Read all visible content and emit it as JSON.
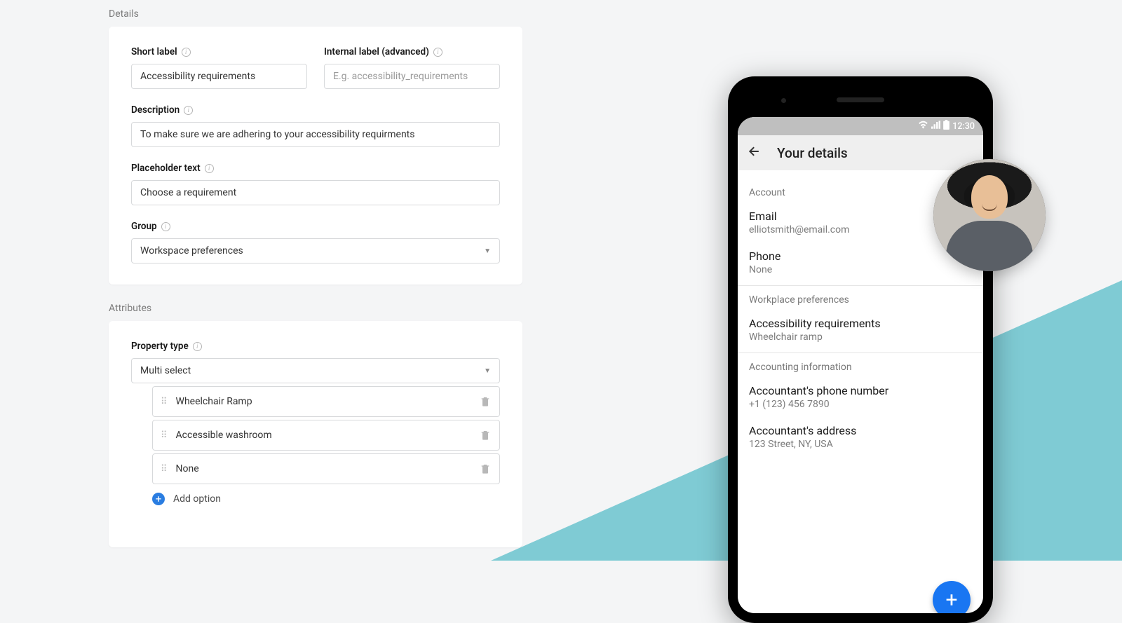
{
  "left": {
    "details_title": "Details",
    "short_label": {
      "label": "Short label",
      "value": "Accessibility requirements"
    },
    "internal_label": {
      "label": "Internal label (advanced)",
      "placeholder": "E.g. accessibility_requirements"
    },
    "description": {
      "label": "Description",
      "value": "To make sure we are adhering to your accessibility requirments"
    },
    "placeholder_text": {
      "label": "Placeholder text",
      "value": "Choose a requirement"
    },
    "group": {
      "label": "Group",
      "value": "Workspace preferences"
    },
    "attributes_title": "Attributes",
    "property_type": {
      "label": "Property type",
      "value": "Multi select"
    },
    "options": [
      {
        "label": "Wheelchair Ramp"
      },
      {
        "label": "Accessible washroom"
      },
      {
        "label": "None"
      }
    ],
    "add_option": "Add option"
  },
  "phone": {
    "time": "12:30",
    "title": "Your details",
    "sections": {
      "account": {
        "header": "Account",
        "email_k": "Email",
        "email_v": "elliotsmith@email.com",
        "phone_k": "Phone",
        "phone_v": "None"
      },
      "workplace": {
        "header": "Workplace preferences",
        "a11y_k": "Accessibility requirements",
        "a11y_v": "Wheelchair ramp"
      },
      "accounting": {
        "header": "Accounting information",
        "phone_k": "Accountant's phone number",
        "phone_v": "+1 (123) 456 7890",
        "addr_k": "Accountant's address",
        "addr_v": "123 Street, NY, USA"
      }
    }
  }
}
